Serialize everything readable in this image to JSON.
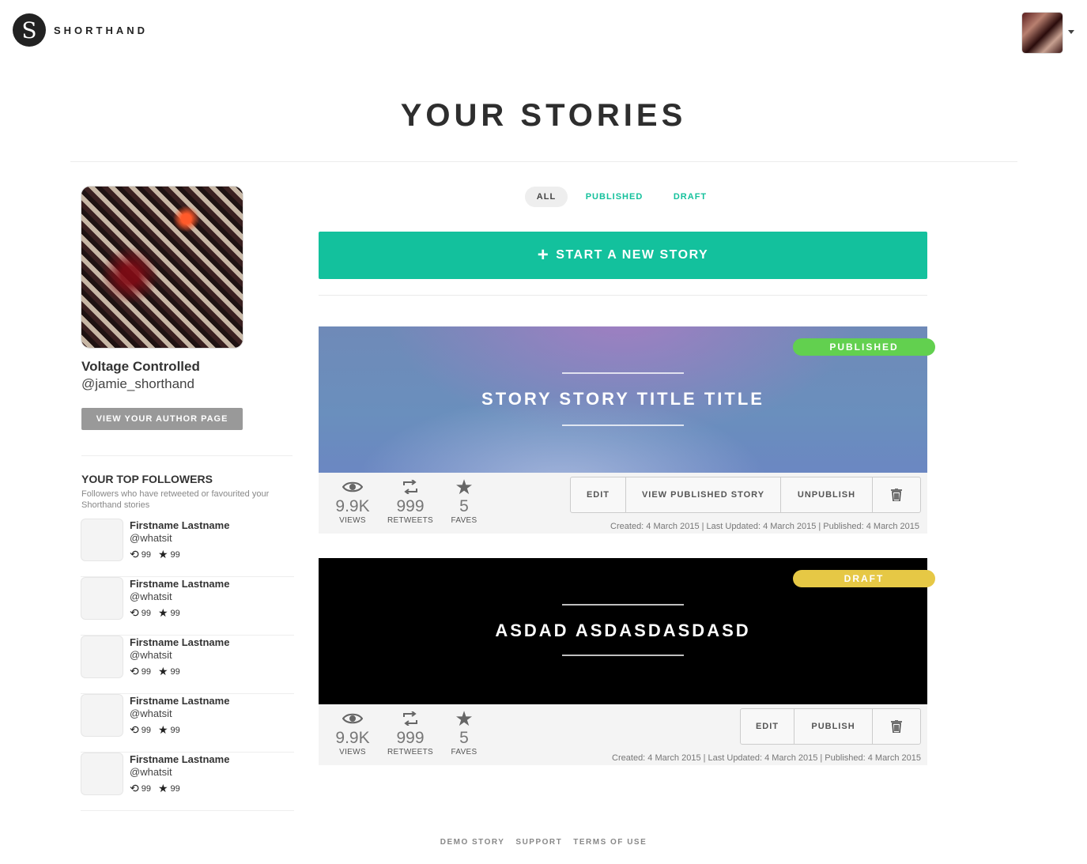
{
  "header": {
    "logo_letter": "S",
    "logo_text": "SHORTHAND"
  },
  "page_title": "YOUR STORIES",
  "profile": {
    "name": "Voltage Controlled",
    "handle": "@jamie_shorthand",
    "author_button": "VIEW YOUR AUTHOR PAGE"
  },
  "followers": {
    "title": "YOUR TOP FOLLOWERS",
    "subtitle": "Followers who have retweeted or favourited your Shorthand stories",
    "items": [
      {
        "name": "Firstname Lastname",
        "handle": "@whatsit",
        "retweets": "99",
        "faves": "99"
      },
      {
        "name": "Firstname Lastname",
        "handle": "@whatsit",
        "retweets": "99",
        "faves": "99"
      },
      {
        "name": "Firstname Lastname",
        "handle": "@whatsit",
        "retweets": "99",
        "faves": "99"
      },
      {
        "name": "Firstname Lastname",
        "handle": "@whatsit",
        "retweets": "99",
        "faves": "99"
      },
      {
        "name": "Firstname Lastname",
        "handle": "@whatsit",
        "retweets": "99",
        "faves": "99"
      }
    ]
  },
  "filters": {
    "all": "ALL",
    "published": "PUBLISHED",
    "draft": "DRAFT",
    "selected": "ALL"
  },
  "new_story_button": "START A NEW STORY",
  "stories": [
    {
      "title": "STORY STORY TITLE TITLE",
      "status": "PUBLISHED",
      "views": "9.9K",
      "views_label": "VIEWS",
      "retweets": "999",
      "retweets_label": "RETWEETS",
      "faves": "5",
      "faves_label": "FAVES",
      "actions": [
        "EDIT",
        "VIEW PUBLISHED STORY",
        "UNPUBLISH"
      ],
      "meta": "Created: 4 March 2015 | Last Updated: 4 March 2015 | Published: 4 March 2015"
    },
    {
      "title": "ASDAD ASDASDASDASD",
      "status": "DRAFT",
      "views": "9.9K",
      "views_label": "VIEWS",
      "retweets": "999",
      "retweets_label": "RETWEETS",
      "faves": "5",
      "faves_label": "FAVES",
      "actions": [
        "EDIT",
        "PUBLISH"
      ],
      "meta": "Created: 4 March 2015 | Last Updated: 4 March 2015 | Published: 4 March 2015"
    }
  ],
  "footer": {
    "links": [
      "DEMO STORY",
      "SUPPORT",
      "TERMS OF USE"
    ]
  },
  "colors": {
    "accent": "#13c19d",
    "published_badge": "#62d04f",
    "draft_badge": "#e6c845"
  },
  "icons": {
    "views": "eye-icon",
    "retweets": "retweet-icon",
    "faves": "star-icon",
    "delete": "trash-icon",
    "add": "plus-icon",
    "menu": "caret-down-icon"
  }
}
